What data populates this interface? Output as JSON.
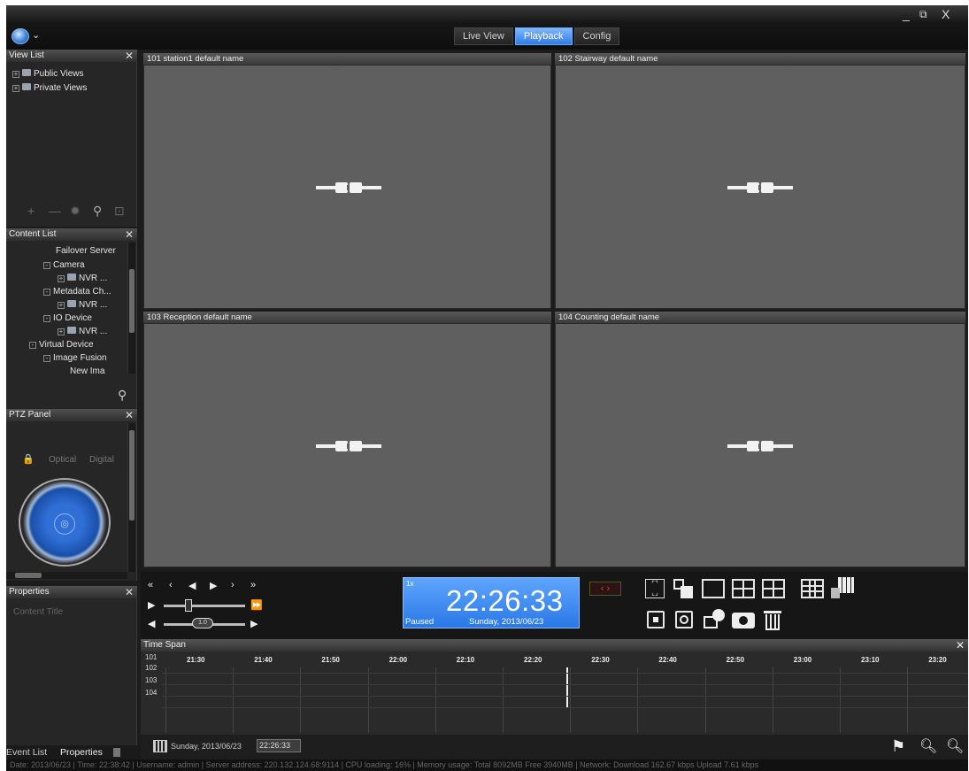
{
  "window": {
    "minimize": "_",
    "restore": "⧉",
    "close": "X"
  },
  "tabs": [
    {
      "label": "Live View"
    },
    {
      "label": "Playback"
    },
    {
      "label": "Config"
    }
  ],
  "view_list": {
    "title": "View List",
    "items": [
      {
        "label": "Public Views"
      },
      {
        "label": "Private Views"
      }
    ]
  },
  "content_list": {
    "title": "Content List",
    "items": [
      {
        "label": "Failover Server"
      },
      {
        "label": "Camera"
      },
      {
        "label": "NVR ..."
      },
      {
        "label": "Metadata Ch..."
      },
      {
        "label": "NVR ..."
      },
      {
        "label": "IO Device"
      },
      {
        "label": "NVR ..."
      },
      {
        "label": "Virtual Device"
      },
      {
        "label": "Image Fusion"
      },
      {
        "label": "New Ima"
      }
    ]
  },
  "ptz_panel": {
    "title": "PTZ Panel",
    "optical_label": "Optical",
    "digital_label": "Digital"
  },
  "properties": {
    "title": "Properties",
    "content_title_label": "Content Title"
  },
  "cameras": [
    {
      "header": "101  station1  default name"
    },
    {
      "header": "102  Stairway  default name"
    },
    {
      "header": "103  Reception  default name"
    },
    {
      "header": "104  Counting  default name"
    }
  ],
  "playback": {
    "time": "22:26:33",
    "state": "Paused",
    "date": "Sunday, 2013/06/23",
    "rate": "1x",
    "speed_value": "1.0"
  },
  "time_span": {
    "title": "Time Span",
    "rows": [
      "101",
      "102",
      "103",
      "104"
    ],
    "ticks": [
      "21:30",
      "21:40",
      "21:50",
      "22:00",
      "22:10",
      "22:20",
      "22:30",
      "22:40",
      "22:50",
      "23:00",
      "23:10",
      "23:20"
    ],
    "footer_date": "Sunday, 2013/06/23",
    "footer_time": "22:26:33"
  },
  "bottom_tabs": {
    "event_list": "Event List",
    "properties": "Properties"
  },
  "status_bar": "Date: 2013/06/23  |  Time: 22:38:42  |  Username: admin  |  Server address: 220.132.124.68:9114  |  CPU loading: 16%  |  Memory usage: Total 8092MB  Free 3940MB  |  Network: Download  162.67 kbps  Upload  7.61 kbps"
}
